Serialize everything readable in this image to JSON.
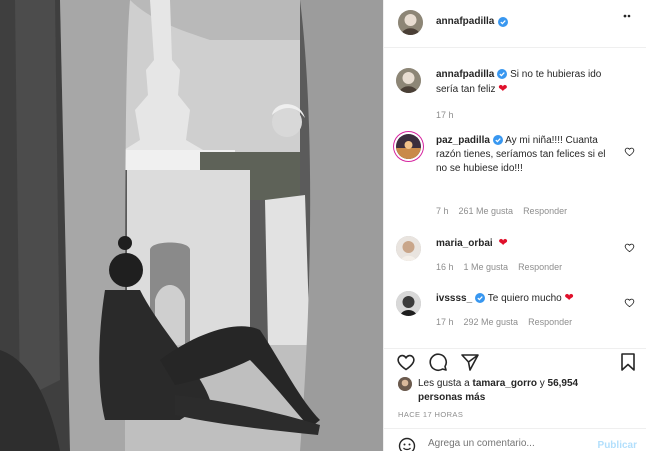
{
  "post": {
    "author": "annafpadilla",
    "verified": true
  },
  "caption": {
    "author": "annafpadilla",
    "text": "Si no te hubieras ido sería tan feliz",
    "emoji": "❤",
    "time": "17 h"
  },
  "comments": [
    {
      "author": "paz_padilla",
      "verified": true,
      "text": "Ay mi niña!!!! Cuanta razón tienes, seríamos tan felices si el no se hubiese ido!!!",
      "emoji": "",
      "time": "7 h",
      "likes": "261 Me gusta",
      "reply": "Responder"
    },
    {
      "author": "maria_orbai",
      "verified": false,
      "text": "",
      "emoji": "❤",
      "time": "16 h",
      "likes": "1 Me gusta",
      "reply": "Responder"
    },
    {
      "author": "ivssss_",
      "verified": true,
      "text": "Te quiero mucho",
      "emoji": "❤",
      "time": "17 h",
      "likes": "292 Me gusta",
      "reply": "Responder"
    }
  ],
  "likes_summary": {
    "prefix": "Les gusta a",
    "first_user": "tamara_gorro",
    "joiner": "y",
    "others": "56,954 personas más"
  },
  "posted_ago": "HACE 17 HORAS",
  "add_comment": {
    "placeholder": "Agrega un comentario...",
    "publish_label": "Publicar"
  },
  "icons": {
    "verified": "verified-badge-icon",
    "close": "close-icon",
    "like": "heart-icon",
    "comment": "comment-icon",
    "share": "paper-plane-icon",
    "save": "bookmark-icon",
    "emoji": "smiley-icon"
  },
  "colors": {
    "verified": "#3897f0",
    "heart_emoji": "#e0102b",
    "muted_text": "#8e8e8e",
    "publish_disabled": "#b2dffc"
  }
}
